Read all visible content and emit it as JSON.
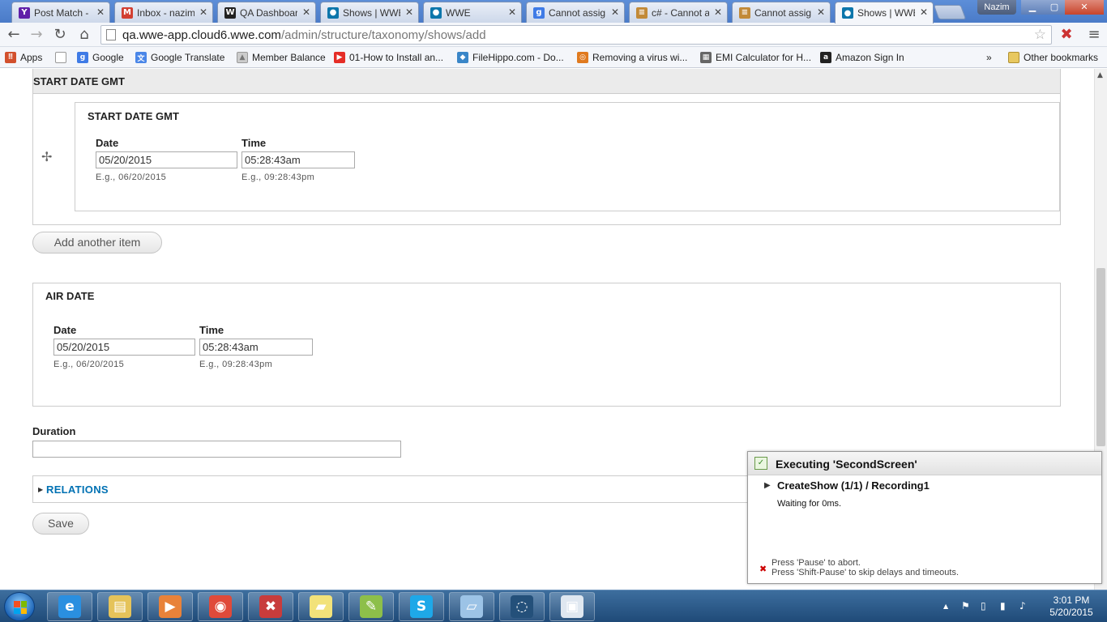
{
  "browser": {
    "tabs": [
      {
        "title": "Post Match -",
        "icon": "yahoo-icon",
        "icon_text": "Y",
        "color": "#5f1fa8"
      },
      {
        "title": "Inbox - nazim",
        "icon": "gmail-icon",
        "icon_text": "M",
        "color": "#d23f31"
      },
      {
        "title": "QA Dashboar",
        "icon": "wwe-icon",
        "icon_text": "W",
        "color": "#222222"
      },
      {
        "title": "Shows | WWE",
        "icon": "drupal-icon",
        "icon_text": "●",
        "color": "#0c76ab"
      },
      {
        "title": "WWE",
        "icon": "drupal-icon",
        "icon_text": "●",
        "color": "#0c76ab"
      },
      {
        "title": "Cannot assig",
        "icon": "google-icon",
        "icon_text": "g",
        "color": "#3f7be6"
      },
      {
        "title": "c# - Cannot a",
        "icon": "stackoverflow-icon",
        "icon_text": "≡",
        "color": "#c28a38"
      },
      {
        "title": "Cannot assig",
        "icon": "stackoverflow-icon",
        "icon_text": "≡",
        "color": "#c28a38"
      },
      {
        "title": "Shows | WWE",
        "icon": "drupal-icon",
        "icon_text": "●",
        "color": "#0c76ab",
        "active": true
      }
    ],
    "close_glyph": "✕",
    "user_name": "Nazim",
    "window": {
      "minimize": "▁",
      "maximize": "▢",
      "close": "✕"
    },
    "nav": {
      "back": "←",
      "forward": "→",
      "reload": "↻",
      "home": "⌂"
    },
    "url_host": "qa.wwe-app.cloud6.wwe.com",
    "url_path": "/admin/structure/taxonomy/shows/add",
    "star_glyph": "☆",
    "extension_glyph": "✖",
    "menu_glyph": "≡",
    "bookmarks": [
      {
        "label": "Apps",
        "icon": "apps-grid-icon",
        "icon_text": "⠿",
        "color": "#d2502d"
      },
      {
        "label": "",
        "icon": "blank-page-icon",
        "icon_text": "",
        "color": "#ffffff"
      },
      {
        "label": "Google",
        "icon": "google-icon",
        "icon_text": "g",
        "color": "#3f7be6"
      },
      {
        "label": "Google Translate",
        "icon": "translate-icon",
        "icon_text": "文",
        "color": "#4a86e8"
      },
      {
        "label": "Member Balance",
        "icon": "bank-icon",
        "icon_text": "▲",
        "color": "#cccccc"
      },
      {
        "label": "01-How to Install an...",
        "icon": "youtube-icon",
        "icon_text": "▶",
        "color": "#e52d27"
      },
      {
        "label": "FileHippo.com - Do...",
        "icon": "filehippo-icon",
        "icon_text": "◆",
        "color": "#3a86c8"
      },
      {
        "label": "Removing a virus wi...",
        "icon": "virus-site-icon",
        "icon_text": "◎",
        "color": "#e07a1f"
      },
      {
        "label": "EMI Calculator for H...",
        "icon": "calculator-icon",
        "icon_text": "▦",
        "color": "#666666"
      },
      {
        "label": "Amazon Sign In",
        "icon": "amazon-icon",
        "icon_text": "a",
        "color": "#222222"
      }
    ],
    "bookmarks_overflow": "»",
    "other_bookmarks": "Other bookmarks"
  },
  "form": {
    "start_date_section_title": "START DATE GMT",
    "start_date_fieldset_title": "START DATE GMT",
    "drag_handle_glyph": "✢",
    "start_date": {
      "date_label": "Date",
      "date_value": "05/20/2015",
      "date_hint": "E.g., 06/20/2015",
      "time_label": "Time",
      "time_value": "05:28:43am",
      "time_hint": "E.g., 09:28:43pm"
    },
    "add_another_label": "Add another item",
    "air_date_title": "AIR DATE",
    "air_date": {
      "date_label": "Date",
      "date_value": "05/20/2015",
      "date_hint": "E.g., 06/20/2015",
      "time_label": "Time",
      "time_value": "05:28:43am",
      "time_hint": "E.g., 09:28:43pm"
    },
    "duration_label": "Duration",
    "duration_value": "",
    "relations_label": "RELATIONS",
    "relations_triangle": "▶",
    "save_label": "Save"
  },
  "popup": {
    "title": "Executing 'SecondScreen'",
    "step": "CreateShow (1/1) / Recording1",
    "play_glyph": "▶",
    "status": "Waiting for 0ms.",
    "abort_glyph": "✖",
    "hint_pause": "Press 'Pause' to abort.",
    "hint_shift_pause": "Press 'Shift-Pause' to skip delays and timeouts."
  },
  "taskbar": {
    "items": [
      {
        "name": "internet-explorer-icon",
        "glyph": "e",
        "color": "#2a8fe0"
      },
      {
        "name": "file-explorer-icon",
        "glyph": "▤",
        "color": "#e5c35a"
      },
      {
        "name": "media-player-icon",
        "glyph": "▶",
        "color": "#e8823a"
      },
      {
        "name": "chrome-icon",
        "glyph": "◉",
        "color": "#e04a3a"
      },
      {
        "name": "tools-icon",
        "glyph": "✖",
        "color": "#c83c3c"
      },
      {
        "name": "sticky-notes-icon",
        "glyph": "▰",
        "color": "#f2e27a"
      },
      {
        "name": "notepad-plus-icon",
        "glyph": "✎",
        "color": "#8dbf4a"
      },
      {
        "name": "skype-icon",
        "glyph": "S",
        "color": "#1ea8e8"
      },
      {
        "name": "tablet-icon",
        "glyph": "▱",
        "color": "#9cc3e6"
      },
      {
        "name": "chat-icon",
        "glyph": "◌",
        "color": "#24507a"
      },
      {
        "name": "app-window-icon",
        "glyph": "▣",
        "color": "#dfe7f0"
      }
    ],
    "tray": {
      "up_arrow": "▲",
      "flag": "⚑",
      "device": "▯",
      "signal": "▮",
      "volume": "♪"
    },
    "time": "3:01 PM",
    "date": "5/20/2015"
  },
  "colors": {
    "link": "#0071b3",
    "taskbar": "#1f4a78",
    "tabstrip": "#4a7bc8"
  }
}
